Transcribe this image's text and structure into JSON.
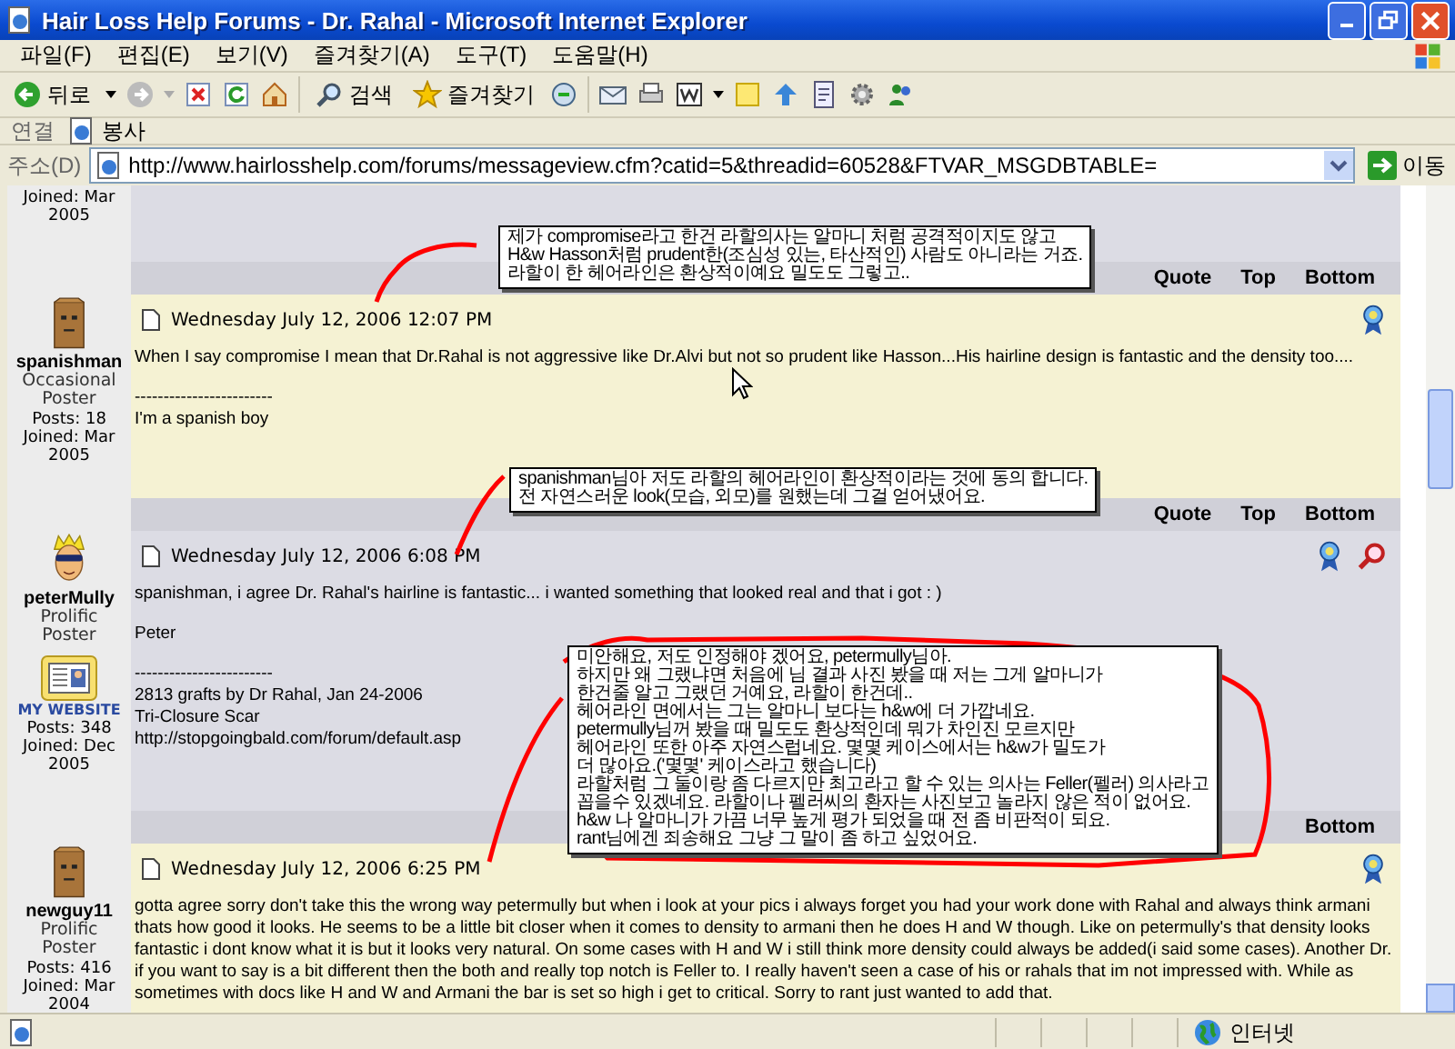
{
  "window": {
    "title": "Hair Loss Help Forums - Dr. Rahal - Microsoft Internet Explorer"
  },
  "menu": [
    "파일(F)",
    "편집(E)",
    "보기(V)",
    "즐겨찾기(A)",
    "도구(T)",
    "도움말(H)"
  ],
  "toolbar": {
    "back": "뒤로",
    "search": "검색",
    "favorites": "즐겨찾기"
  },
  "links_bar": {
    "label": "연결",
    "items": [
      "봉사"
    ]
  },
  "address_bar": {
    "label": "주소(D)",
    "url": "http://www.hairlosshelp.com/forums/messageview.cfm?catid=5&threadid=60528&FTVAR_MSGDBTABLE=",
    "go": "이동"
  },
  "posts": [
    {
      "kind": "partial",
      "joined": "Joined: Mar 2005",
      "actions": [
        "Quote",
        "Top",
        "Bottom"
      ]
    },
    {
      "kind": "full",
      "avatar": {
        "kind": "bag"
      },
      "author": "spanishman",
      "rank": "Occasional Poster",
      "count": "Posts: 18",
      "joined": "Joined: Mar 2005",
      "date": "Wednesday July 12, 2006 12:07 PM",
      "badges": [
        {
          "kind": "ribbon"
        }
      ],
      "body": [
        "When I say compromise I mean that Dr.Rahal is not aggressive like Dr.Alvi but not so prudent like Hasson...His hairline design is fantastic and the density too....",
        "------------------------\nI'm a spanish boy"
      ],
      "actions": [
        "Quote",
        "Top",
        "Bottom"
      ]
    },
    {
      "kind": "full",
      "avatar": {
        "kind": "cartoon"
      },
      "author": "peterMully",
      "rank": "Prolific Poster",
      "website": "MY WEBSITE",
      "count": "Posts: 348",
      "joined": "Joined: Dec 2005",
      "date": "Wednesday July 12, 2006 6:08 PM",
      "badges": [
        {
          "kind": "ribbon"
        },
        {
          "kind": "search"
        }
      ],
      "body": [
        "spanishman, i agree Dr. Rahal's hairline is fantastic... i wanted something that looked real and that i got : )",
        "Peter",
        "------------------------\n2813 grafts by Dr Rahal, Jan 24-2006\nTri-Closure Scar\nhttp://stopgoingbald.com/forum/default.asp"
      ],
      "actions": [
        "Bottom"
      ]
    },
    {
      "kind": "full",
      "avatar": {
        "kind": "bag"
      },
      "author": "newguy11",
      "rank": "Prolific Poster",
      "count": "Posts: 416",
      "joined": "Joined: Mar 2004",
      "date": "Wednesday July 12, 2006 6:25 PM",
      "badges": [
        {
          "kind": "ribbon"
        }
      ],
      "body": [
        "gotta agree sorry don't take this the wrong way petermully but when i look at your pics i always forget you had your work done with Rahal and always think armani thats how good it looks. He seems to be a little bit closer when it comes to density to armani then he does H and W though. Like on petermully's that density looks fantastic i dont know what it is but it looks very natural. On some cases with H and W i still think more density could always be added(i said some cases). Another Dr. if you want to say is a bit different then the both and really top notch is Feller to. I really haven't seen a case of his or rahals that im not impressed with. While as sometimes with docs like H and W and Armani the bar is set so high i get to critical. Sorry to rant just wanted to add that."
      ]
    }
  ],
  "annotations": [
    {
      "lines": [
        "제가 compromise라고 한건 라할의사는 알마니 처럼 공격적이지도 않고",
        "H&w Hasson처럼 prudent한(조심성 있는, 타산적인) 사람도 아니라는 거죠.",
        "라할이 한 헤어라인은 환상적이예요 밀도도 그렇고.."
      ]
    },
    {
      "lines": [
        "spanishman님아 저도 라할의 헤어라인이 환상적이라는 것에 동의 합니다.",
        "전 자연스러운 look(모습, 외모)를 원했는데 그걸 얻어냈어요."
      ]
    },
    {
      "lines": [
        "미안해요, 저도 인정해야 겠어요, petermully님아.",
        "하지만 왜 그랬냐면 처음에 님 결과 사진 봤을 때 저는 그게 알마니가",
        "한건줄 알고 그랬던 거예요, 라할이 한건데..",
        "헤어라인 면에서는 그는 알마니 보다는 h&w에 더 가깝네요.",
        "petermully님꺼 봤을 때 밀도도 환상적인데 뭐가 차인진 모르지만",
        "헤어라인 또한 아주 자연스럽네요. 몇몇 케이스에서는 h&w가 밀도가",
        "더 많아요.('몇몇' 케이스라고 했습니다)",
        "라할처럼 그 둘이랑 좀 다르지만 최고라고 할 수 있는 의사는 Feller(펠러) 의사라고",
        "꼽을수 있겠네요. 라할이나 펠러씨의 환자는 사진보고 놀라지 않은 적이 없어요.",
        "h&w 나 알마니가 가끔  너무 높게 평가 되었을 때 전 좀 비판적이 되요.",
        "rant님에겐 죄송해요 그냥 그 말이 좀 하고 싶었어요."
      ]
    }
  ],
  "status_bar": {
    "zone": "인터넷"
  }
}
